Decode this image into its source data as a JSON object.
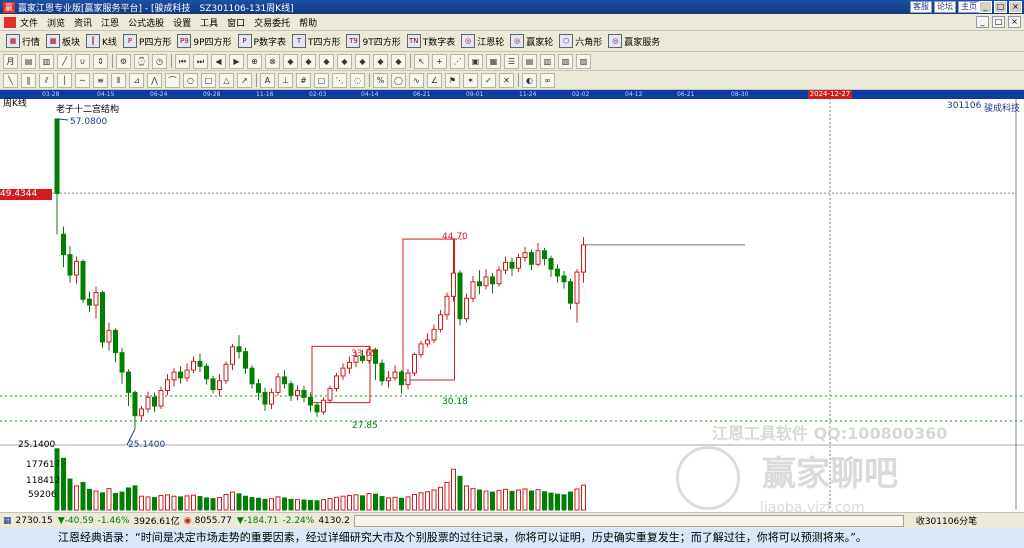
{
  "title_bar": {
    "title": "赢家江恩专业版[赢家服务平台] - [骏成科技　SZ301106-131周K线]",
    "links": [
      "客服",
      "论坛",
      "主页"
    ],
    "window_controls": [
      "_",
      "□",
      "×"
    ]
  },
  "menu": {
    "items": [
      "文件",
      "浏览",
      "资讯",
      "江恩",
      "公式选股",
      "设置",
      "工具",
      "窗口",
      "交易委托",
      "帮助"
    ],
    "window_controls": [
      "_",
      "□",
      "×"
    ]
  },
  "toolbar": {
    "items": [
      {
        "label": "行情",
        "icon": "grid-icon"
      },
      {
        "label": "板块",
        "icon": "blocks-icon"
      },
      {
        "label": "K线",
        "icon": "candle-icon"
      },
      {
        "label": "P四方形",
        "icon": "p-square-icon",
        "badge": "P"
      },
      {
        "label": "9P四方形",
        "icon": "9p-square-icon",
        "badge": "P9"
      },
      {
        "label": "P数字表",
        "icon": "p-table-icon",
        "badge": "P"
      },
      {
        "label": "T四方形",
        "icon": "t-square-icon",
        "badge": "T"
      },
      {
        "label": "9T四方形",
        "icon": "9t-square-icon",
        "badge": "T9"
      },
      {
        "label": "T数字表",
        "icon": "t-table-icon",
        "badge": "TN"
      },
      {
        "label": "江恩轮",
        "icon": "wheel-icon",
        "badge": "◎"
      },
      {
        "label": "赢家轮",
        "icon": "winner-wheel-icon",
        "badge": "◎"
      },
      {
        "label": "六角形",
        "icon": "hexagon-icon",
        "badge": "⬡"
      },
      {
        "label": "赢家服务",
        "icon": "service-icon",
        "badge": "◎"
      }
    ]
  },
  "chart_header": {
    "period": "周K线",
    "code": "301106",
    "name": "骏成科技",
    "indicator_title": "老子十二宫结构"
  },
  "date_axis": {
    "labels": [
      "03-28",
      "04-15",
      "06-24",
      "09-28",
      "11-16",
      "02-03",
      "04-14",
      "06-21",
      "09-01",
      "11-24",
      "02-02",
      "04-12",
      "06-21",
      "08-30"
    ],
    "cursor_label": "2024-12-27"
  },
  "price_labels": {
    "cursor_price": "49.4344",
    "high": "57.0800",
    "low": "25.1400",
    "low_axis": "25.1400",
    "box1_top": "33.65",
    "box1_bottom": "27.85",
    "box2_top": "44.70",
    "box2_bottom": "30.18"
  },
  "volume_axis": [
    "177617",
    "118412",
    "59206"
  ],
  "status": {
    "sh": "2730.15",
    "sh_chg": "▼-40.59",
    "sh_pct": "-1.46%",
    "sh_amt": "3926.61亿",
    "sz": "8055.77",
    "sz_chg": "▼-184.71",
    "sz_pct": "-2.24%",
    "sz_amt": "4130.2",
    "right": "收301106分笔"
  },
  "watermark": {
    "line1": "江恩工具软件 QQ:100800360",
    "line2": "赢家聊吧",
    "line3": "liaoba.yjzf.com"
  },
  "quote": "江恩经典语录：“时间是决定市场走势的重要因素，经过详细研究大市及个别股票的过往记录，你将可以证明，历史确实重复发生；而了解过往，你将可以预测将来。”。",
  "colors": {
    "up": "#d01c1c",
    "down": "#008000",
    "cursor": "#d01c1c",
    "title_bar": "#1e4fa3"
  },
  "chart_data": {
    "type": "candlestick",
    "period": "weekly",
    "series": [
      {
        "name": "price",
        "values": [
          [
            57.08,
            49.4,
            57.08,
            45.2
          ],
          [
            45.2,
            43.1,
            46.0,
            41.8
          ],
          [
            43.1,
            41.0,
            44.0,
            40.2
          ],
          [
            41.0,
            42.4,
            42.9,
            40.1
          ],
          [
            42.4,
            38.5,
            42.6,
            38.1
          ],
          [
            38.5,
            37.9,
            39.3,
            37.2
          ],
          [
            37.9,
            39.2,
            39.8,
            36.5
          ],
          [
            39.2,
            34.1,
            39.4,
            33.5
          ],
          [
            34.1,
            35.3,
            36.1,
            33.2
          ],
          [
            35.3,
            33.0,
            35.5,
            32.0
          ],
          [
            33.0,
            31.0,
            33.5,
            29.8
          ],
          [
            31.0,
            28.9,
            31.3,
            27.5
          ],
          [
            28.9,
            26.5,
            29.1,
            25.14
          ],
          [
            26.5,
            27.2,
            27.5,
            26.0
          ],
          [
            27.2,
            28.4,
            29.0,
            26.8
          ],
          [
            28.4,
            27.5,
            28.9,
            26.9
          ],
          [
            27.5,
            29.1,
            29.5,
            27.2
          ],
          [
            29.1,
            30.2,
            30.8,
            28.6
          ],
          [
            30.2,
            31.0,
            31.4,
            29.5
          ],
          [
            31.0,
            30.4,
            31.6,
            29.8
          ],
          [
            30.4,
            31.2,
            31.9,
            30.0
          ],
          [
            31.2,
            32.1,
            32.6,
            30.9
          ],
          [
            32.1,
            31.6,
            32.9,
            31.0
          ],
          [
            31.6,
            30.3,
            31.9,
            29.7
          ],
          [
            30.3,
            29.2,
            30.6,
            28.8
          ],
          [
            29.2,
            30.1,
            30.8,
            28.5
          ],
          [
            30.1,
            31.8,
            32.1,
            29.8
          ],
          [
            31.8,
            33.6,
            33.9,
            31.2
          ],
          [
            33.6,
            33.1,
            34.8,
            32.4
          ],
          [
            33.1,
            31.4,
            33.5,
            30.8
          ],
          [
            31.4,
            29.8,
            31.7,
            29.3
          ],
          [
            29.8,
            28.9,
            30.3,
            28.1
          ],
          [
            28.9,
            27.7,
            29.4,
            27.0
          ],
          [
            27.7,
            28.9,
            29.3,
            27.2
          ],
          [
            28.9,
            30.5,
            30.9,
            28.6
          ],
          [
            30.5,
            29.8,
            31.2,
            29.3
          ],
          [
            29.8,
            28.6,
            30.1,
            28.0
          ],
          [
            28.6,
            29.1,
            29.6,
            28.1
          ],
          [
            29.1,
            28.4,
            29.6,
            27.9
          ],
          [
            28.4,
            27.6,
            28.9,
            26.9
          ],
          [
            27.6,
            26.9,
            27.9,
            26.4
          ],
          [
            26.9,
            28.1,
            28.4,
            26.6
          ],
          [
            28.1,
            29.3,
            29.6,
            27.8
          ],
          [
            29.3,
            30.6,
            30.9,
            29.0
          ],
          [
            30.6,
            31.4,
            31.9,
            30.2
          ],
          [
            31.4,
            32.0,
            32.6,
            30.8
          ],
          [
            32.0,
            32.6,
            33.1,
            31.5
          ],
          [
            32.6,
            32.2,
            33.3,
            31.9
          ],
          [
            32.2,
            33.3,
            33.65,
            31.9
          ],
          [
            33.3,
            31.9,
            33.5,
            30.2
          ],
          [
            31.9,
            30.1,
            32.3,
            29.6
          ],
          [
            30.1,
            30.4,
            31.1,
            29.4
          ],
          [
            30.4,
            31.0,
            31.7,
            30.1
          ],
          [
            31.0,
            29.7,
            31.2,
            28.8
          ],
          [
            29.7,
            30.9,
            31.3,
            29.2
          ],
          [
            30.9,
            32.8,
            33.0,
            30.6
          ],
          [
            32.8,
            33.9,
            34.2,
            32.5
          ],
          [
            33.9,
            34.3,
            35.0,
            33.6
          ],
          [
            34.3,
            35.4,
            35.9,
            34.0
          ],
          [
            35.4,
            36.9,
            37.4,
            35.1
          ],
          [
            36.9,
            38.8,
            39.2,
            36.4
          ],
          [
            38.8,
            41.2,
            44.7,
            38.3
          ],
          [
            41.2,
            36.5,
            41.5,
            35.8
          ],
          [
            36.5,
            38.6,
            39.1,
            36.1
          ],
          [
            38.6,
            40.3,
            40.9,
            38.2
          ],
          [
            40.3,
            39.9,
            41.5,
            39.0
          ],
          [
            39.9,
            40.8,
            41.6,
            39.5
          ],
          [
            40.8,
            40.1,
            41.2,
            39.1
          ],
          [
            40.1,
            41.5,
            41.9,
            39.8
          ],
          [
            41.5,
            42.3,
            42.9,
            41.1
          ],
          [
            42.3,
            41.7,
            42.8,
            40.9
          ],
          [
            41.7,
            42.8,
            43.2,
            41.3
          ],
          [
            42.8,
            43.3,
            43.9,
            42.4
          ],
          [
            43.3,
            42.1,
            43.6,
            41.5
          ],
          [
            42.1,
            43.5,
            44.3,
            41.9
          ],
          [
            43.5,
            42.7,
            43.8,
            42.0
          ],
          [
            42.7,
            41.6,
            43.0,
            40.8
          ],
          [
            41.6,
            40.9,
            42.1,
            40.2
          ],
          [
            40.9,
            40.3,
            41.4,
            39.6
          ],
          [
            40.3,
            38.1,
            40.6,
            37.5
          ],
          [
            38.1,
            41.3,
            41.6,
            36.1
          ],
          [
            41.3,
            44.1,
            44.9,
            40.2
          ]
        ]
      },
      {
        "name": "volume",
        "values": [
          177617,
          150000,
          90000,
          70000,
          80000,
          60000,
          55000,
          50000,
          62000,
          48000,
          52000,
          64000,
          70000,
          40000,
          38000,
          36000,
          42000,
          44000,
          40000,
          38000,
          41000,
          43000,
          39000,
          35000,
          33000,
          36000,
          45000,
          52000,
          47000,
          40000,
          36000,
          34000,
          31000,
          33000,
          38000,
          35000,
          31000,
          30000,
          29000,
          28000,
          27000,
          30000,
          33000,
          37000,
          40000,
          42000,
          44000,
          41000,
          48000,
          46000,
          39000,
          35000,
          37000,
          34000,
          38000,
          45000,
          50000,
          53000,
          58000,
          66000,
          80000,
          118412,
          98000,
          70000,
          62000,
          58000,
          55000,
          52000,
          57000,
          60000,
          54000,
          58000,
          61000,
          55000,
          59000,
          53000,
          49000,
          46000,
          44000,
          52000,
          61000,
          72000
        ]
      }
    ],
    "x_labels": [
      "03-28",
      "04-15",
      "06-24",
      "09-28",
      "11-16",
      "02-03",
      "04-14",
      "06-21",
      "09-01",
      "11-24",
      "02-02",
      "04-12",
      "06-21",
      "08-30"
    ],
    "ylim": [
      25.14,
      57.08
    ],
    "annotations": [
      "57.0800",
      "25.1400",
      "33.65",
      "27.85",
      "44.70",
      "30.18"
    ],
    "cursor": {
      "date": "2024-12-27",
      "price": 49.4344
    }
  }
}
